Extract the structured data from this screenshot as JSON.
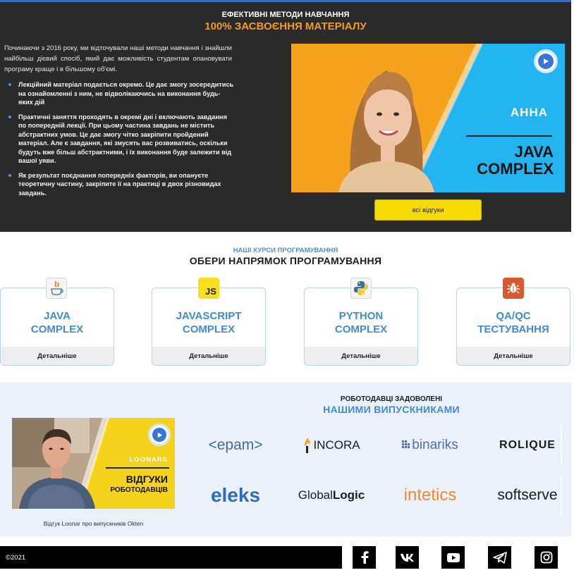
{
  "methods": {
    "kicker": "ЕФЕКТИВНІ МЕТОДИ НАВЧАННЯ",
    "title": "100% ЗАСВОЄННЯ МАТЕРІАЛУ",
    "intro": "Починаючи з 2016 року, ми відточували наші методи навчання і знайшли найбільш дієвий спосіб, який дає можливість студентам опановувати програму краще і в більшому об'ємі.",
    "bullets": [
      "Лекційний матеріал подається окремо. Це дає змогу зосередитись на ознайомленні з ним, не відволікаючись на виконання будь-яких дій",
      "Практичні заняття проходять в окремі дні і включають завдання по попередній лекції. При цьому частина завдань не містить абстрактних умов. Це дає змогу чітко закріпити пройдений матеріал. Але є завдання, які змусять вас розвиватись, оскільки будуть вже більш абстрактними, і їх виконання буде залежити від вашої уяви.",
      "Як результат поєднання попередніх факторів, ви опануєте теоретичну частину, закріпите її на практиці в двох різновидах завдань."
    ],
    "video": {
      "name": "АННА",
      "course_line1": "JAVA",
      "course_line2": "COMPLEX"
    },
    "reviews_button": "всі відгуки"
  },
  "courses": {
    "kicker": "НАШІ КУРСИ ПРОГРАМУВАННЯ",
    "title": "ОБЕРИ НАПРЯМОК ПРОГРАМУВАННЯ",
    "items": [
      {
        "line1": "JAVA",
        "line2": "COMPLEX",
        "more": "Детальніше",
        "icon": "java-icon"
      },
      {
        "line1": "JAVASCRIPT",
        "line2": "COMPLEX",
        "more": "Детальніше",
        "icon": "javascript-icon",
        "icon_text": "JS"
      },
      {
        "line1": "PYTHON",
        "line2": "COMPLEX",
        "more": "Детальніше",
        "icon": "python-icon"
      },
      {
        "line1": "QA/QC",
        "line2": "ТЕСТУВАННЯ",
        "more": "Детальніше",
        "icon": "bug-icon"
      }
    ]
  },
  "employers": {
    "kicker": "РОБОТОДАВЦІ ЗАДОВОЛЕНІ",
    "title": "НАШИМИ ВИПУСКНИКАМИ",
    "video": {
      "brand": "LOONARS",
      "line1": "ВІДГУКИ",
      "line2": "РОБОТОДАВЦІВ"
    },
    "caption": "Відгук Loonar про випускників Okten",
    "logos": {
      "epam": "<epam>",
      "incora": "INCORA",
      "binariks": "binariks",
      "rolique": "ROLIQUE",
      "eleks": "eleks",
      "globallogic_a": "Global",
      "globallogic_b": "Logic",
      "intetics": "intetics",
      "softserve": "softserve"
    }
  },
  "footer": {
    "copyright": "©2021",
    "social": [
      "facebook-icon",
      "vk-icon",
      "youtube-icon",
      "telegram-icon",
      "instagram-icon"
    ]
  },
  "colors": {
    "accent_orange": "#f39c1f",
    "accent_blue": "#3f8ad9",
    "button_yellow": "#f7dc00",
    "dark_bg": "#2a2a2a",
    "light_section_bg": "#eaf1fa"
  }
}
